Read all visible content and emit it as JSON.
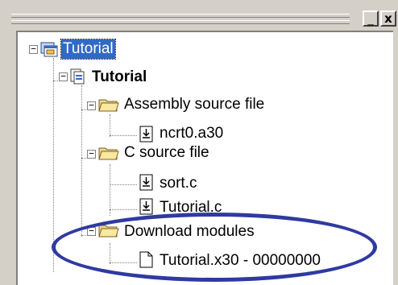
{
  "window": {
    "minimize_glyph": "_",
    "close_glyph": "x"
  },
  "tree": {
    "workspace": {
      "label": "Tutorial",
      "expander": "−",
      "icon": "workspace-icon"
    },
    "project": {
      "label": "Tutorial",
      "expander": "−",
      "icon": "project-icon"
    },
    "folders": [
      {
        "label": "Assembly source file",
        "expander": "−",
        "icon": "folder-icon",
        "files": [
          {
            "label": "ncrt0.a30",
            "icon": "source-file-icon"
          }
        ]
      },
      {
        "label": "C source file",
        "expander": "−",
        "icon": "folder-icon",
        "files": [
          {
            "label": "sort.c",
            "icon": "source-file-icon"
          },
          {
            "label": "Tutorial.c",
            "icon": "source-file-icon"
          }
        ]
      },
      {
        "label": "Download modules",
        "expander": "−",
        "icon": "folder-icon",
        "files": [
          {
            "label": "Tutorial.x30 - 00000000",
            "icon": "document-icon"
          }
        ]
      }
    ]
  },
  "annotation": {
    "color": "#2f3aa0"
  },
  "colors": {
    "selection": "#316ac5",
    "panel": "#d4d0c8"
  }
}
